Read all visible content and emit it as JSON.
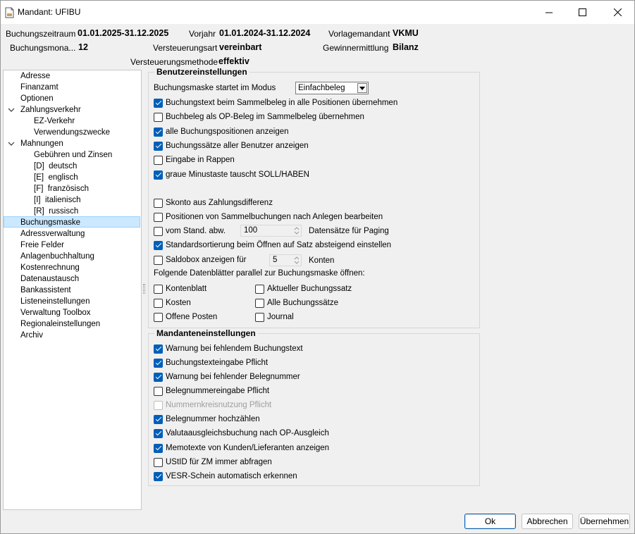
{
  "window": {
    "title": "Mandant: UFIBU"
  },
  "header": {
    "buchungszeitraum_label": "Buchungszeitraum",
    "buchungszeitraum_value": "01.01.2025-31.12.2025",
    "vorjahr_label": "Vorjahr",
    "vorjahr_value": "01.01.2024-31.12.2024",
    "vorlagemandant_label": "Vorlagemandant",
    "vorlagemandant_value": "VKMU",
    "buchungsmonat_label": "Buchungsmona...",
    "buchungsmonat_value": "12",
    "versteuerungsart_label": "Versteuerungsart",
    "versteuerungsart_value": "vereinbart",
    "gewinnermittlung_label": "Gewinnermittlung",
    "gewinnermittlung_value": "Bilanz",
    "versteuerungsmethode_label": "Versteuerungsmethode",
    "versteuerungsmethode_value": "effektiv"
  },
  "tree": {
    "items": [
      {
        "label": "Adresse"
      },
      {
        "label": "Finanzamt"
      },
      {
        "label": "Optionen"
      },
      {
        "label": "Zahlungsverkehr"
      },
      {
        "label": "EZ-Verkehr"
      },
      {
        "label": "Verwendungszwecke"
      },
      {
        "label": "Mahnungen"
      },
      {
        "label": "Gebühren und Zinsen"
      },
      {
        "label": "[D]  deutsch"
      },
      {
        "label": "[E]  englisch"
      },
      {
        "label": "[F]  französisch"
      },
      {
        "label": "[I]  italienisch"
      },
      {
        "label": "[R]  russisch"
      },
      {
        "label": "Buchungsmaske"
      },
      {
        "label": "Adressverwaltung"
      },
      {
        "label": "Freie Felder"
      },
      {
        "label": "Anlagenbuchhaltung"
      },
      {
        "label": "Kostenrechnung"
      },
      {
        "label": "Datenaustausch"
      },
      {
        "label": "Bankassistent"
      },
      {
        "label": "Listeneinstellungen"
      },
      {
        "label": "Verwaltung Toolbox"
      },
      {
        "label": "Regionaleinstellungen"
      },
      {
        "label": "Archiv"
      }
    ]
  },
  "benutzer": {
    "title": "Benutzereinstellungen",
    "modus_label": "Buchungsmaske startet im Modus",
    "modus_value": "Einfachbeleg",
    "options": [
      {
        "label": "Buchungstext beim Sammelbeleg in alle Positionen übernehmen",
        "checked": true
      },
      {
        "label": "Buchbeleg als OP-Beleg im Sammelbeleg übernehmen",
        "checked": false
      },
      {
        "label": "alle Buchungspositionen anzeigen",
        "checked": true
      },
      {
        "label": "Buchungssätze aller Benutzer anzeigen",
        "checked": true
      },
      {
        "label": "Eingabe in Rappen",
        "checked": false
      },
      {
        "label": "graue Minustaste tauscht SOLL/HABEN",
        "checked": true
      },
      {
        "label": "Skonto aus Zahlungsdifferenz",
        "checked": false
      },
      {
        "label": "Positionen von Sammelbuchungen nach Anlegen bearbeiten",
        "checked": false
      }
    ],
    "paging_label": "vom Stand. abw.",
    "paging_value": "100",
    "paging_suffix": "Datensätze für Paging",
    "sort_label": "Standardsortierung beim Öffnen auf Satz absteigend einstellen",
    "saldo_label": "Saldobox anzeigen für",
    "saldo_value": "5",
    "saldo_suffix": "Konten",
    "datenblaetter_label": "Folgende Datenblätter parallel zur Buchungsmaske öffnen:",
    "sheets_left": [
      {
        "label": "Kontenblatt",
        "checked": false
      },
      {
        "label": "Kosten",
        "checked": false
      },
      {
        "label": "Offene Posten",
        "checked": false
      }
    ],
    "sheets_right": [
      {
        "label": "Aktueller Buchungssatz",
        "checked": false
      },
      {
        "label": "Alle Buchungssätze",
        "checked": false
      },
      {
        "label": "Journal",
        "checked": false
      }
    ]
  },
  "mandant": {
    "title": "Mandanteneinstellungen",
    "options": [
      {
        "label": "Warnung bei fehlendem Buchungstext",
        "checked": true
      },
      {
        "label": "Buchungstexteingabe Pflicht",
        "checked": true
      },
      {
        "label": "Warnung bei fehlender Belegnummer",
        "checked": true
      },
      {
        "label": "Belegnummereingabe Pflicht",
        "checked": false
      },
      {
        "label": "Nummernkreisnutzung Pflicht",
        "checked": false
      },
      {
        "label": "Belegnummer hochzählen",
        "checked": true
      },
      {
        "label": "Valutaausgleichsbuchung nach OP-Ausgleich",
        "checked": true
      },
      {
        "label": "Memotexte von Kunden/Lieferanten anzeigen",
        "checked": true
      },
      {
        "label": "UStID für ZM immer abfragen",
        "checked": false
      },
      {
        "label": "VESR-Schein automatisch erkennen",
        "checked": true
      }
    ]
  },
  "buttons": {
    "ok": "Ok",
    "cancel": "Abbrechen",
    "apply": "Übernehmen"
  }
}
